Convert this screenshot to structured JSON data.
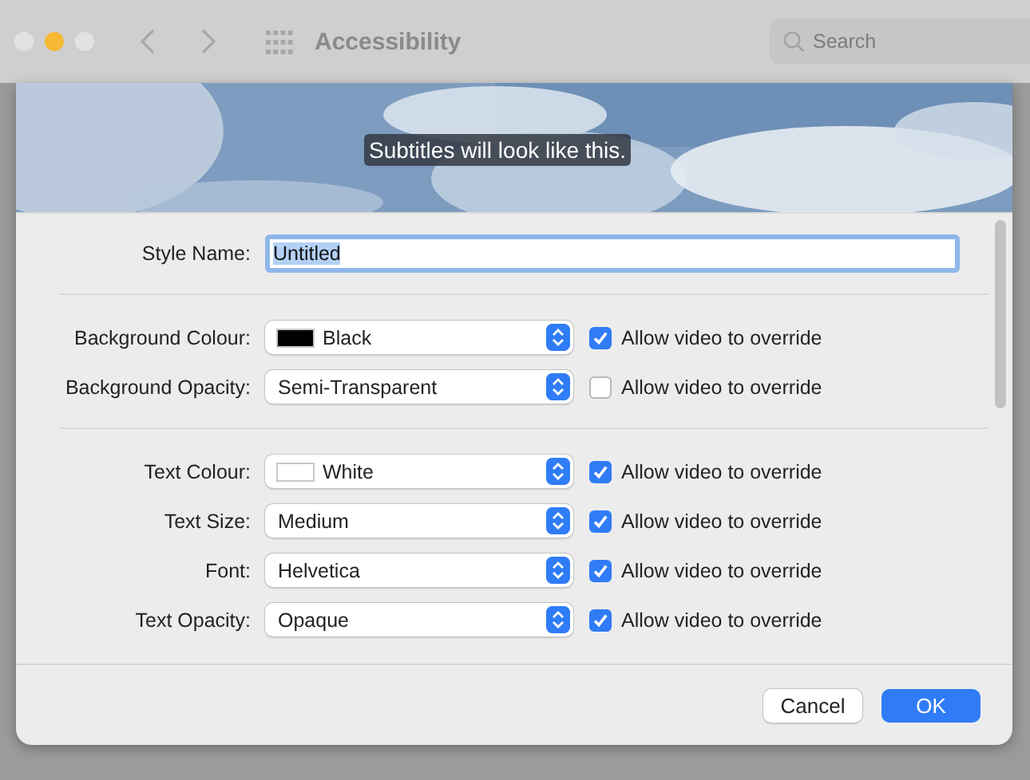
{
  "window": {
    "title": "Accessibility",
    "search": {
      "placeholder": "Search"
    }
  },
  "preview": {
    "kind": "picture",
    "caption": "Subtitles will look like this."
  },
  "style_name": {
    "label": "Style Name:",
    "value": "Untitled"
  },
  "groups": [
    [
      {
        "label": "Background Colour:",
        "value": "Black",
        "color": "#000000",
        "override": {
          "label": "Allow video to override",
          "checked": true
        }
      },
      {
        "label": "Background Opacity:",
        "value": "Semi-Transparent",
        "override": {
          "label": "Allow video to override",
          "checked": false
        }
      }
    ],
    [
      {
        "label": "Text Colour:",
        "value": "White",
        "color": "#ffffff",
        "override": {
          "label": "Allow video to override",
          "checked": true
        }
      },
      {
        "label": "Text Size:",
        "value": "Medium",
        "override": {
          "label": "Allow video to override",
          "checked": true
        }
      },
      {
        "label": "Font:",
        "value": "Helvetica",
        "override": {
          "label": "Allow video to override",
          "checked": true
        }
      },
      {
        "label": "Text Opacity:",
        "value": "Opaque",
        "override": {
          "label": "Allow video to override",
          "checked": true
        }
      }
    ]
  ],
  "buttons": [
    {
      "label": "Cancel",
      "kind": "normal"
    },
    {
      "label": "OK",
      "kind": "default"
    }
  ]
}
